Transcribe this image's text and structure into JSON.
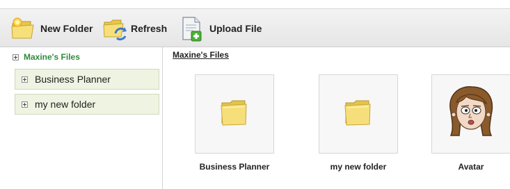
{
  "toolbar": {
    "new_folder_label": "New Folder",
    "refresh_label": "Refresh",
    "upload_file_label": "Upload File"
  },
  "sidebar": {
    "root_label": "Maxine's Files",
    "items": [
      {
        "label": "Business Planner"
      },
      {
        "label": "my new folder"
      }
    ]
  },
  "main": {
    "breadcrumb": "Maxine's Files",
    "tiles": [
      {
        "label": "Business Planner",
        "icon": "folder-icon"
      },
      {
        "label": "my new folder",
        "icon": "folder-icon"
      },
      {
        "label": "Avatar",
        "icon": "avatar-image"
      }
    ]
  },
  "colors": {
    "root_label": "#2e8b3c",
    "tree_item_bg": "#eef3e2",
    "folder_yellow": "#f3d35a"
  }
}
